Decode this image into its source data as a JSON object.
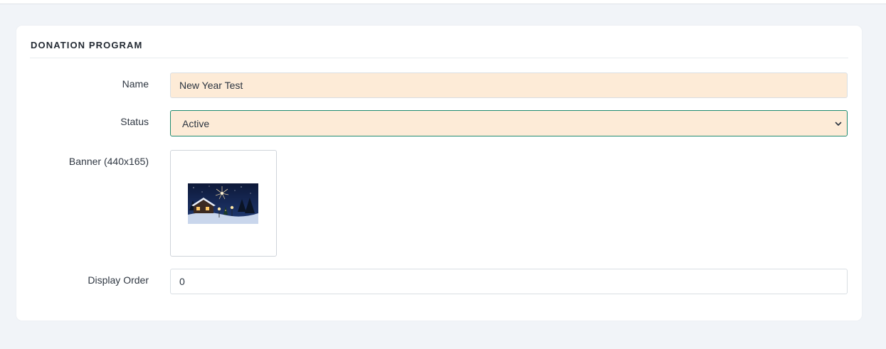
{
  "section": {
    "title": "DONATION PROGRAM"
  },
  "form": {
    "name": {
      "label": "Name",
      "value": "New Year Test"
    },
    "status": {
      "label": "Status",
      "value": "Active"
    },
    "banner": {
      "label": "Banner (440x165)",
      "image": "winter-night-village-banner"
    },
    "display_order": {
      "label": "Display Order",
      "value": "0"
    }
  },
  "colors": {
    "page_bg": "#f1f4f8",
    "field_autofill_bg": "#fdebd7",
    "focus_border": "#1f8a6e"
  }
}
